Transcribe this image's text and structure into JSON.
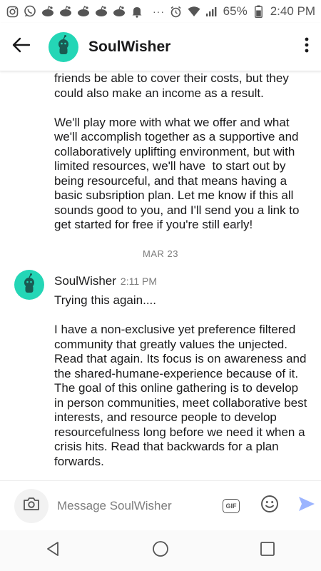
{
  "status_bar": {
    "battery_percent": "65%",
    "time": "2:40 PM",
    "more_indicator": "···",
    "icons": [
      "instagram-icon",
      "whatsapp-icon",
      "reddit-icon",
      "reddit-icon",
      "reddit-icon",
      "reddit-icon",
      "reddit-icon",
      "notification-bell-icon",
      "alarm-icon",
      "wifi-icon",
      "signal-icon",
      "battery-icon"
    ]
  },
  "header": {
    "title": "SoulWisher",
    "back_icon": "arrow-left-icon",
    "menu_icon": "more-vertical-icon"
  },
  "chat": {
    "previous_message_continued": "friends be able to cover their costs, but they could also make an income as a result.\n\nWe'll play more with what we offer and what we'll accomplish together as a supportive and collaboratively uplifting environment, but with limited resources, we'll have  to start out by being resourceful, and that means having a basic subsription plan. Let me know if this all sounds good to you, and I'll send you a link to get started for free if you're still early!",
    "date_separator": "MAR 23",
    "message": {
      "author": "SoulWisher",
      "time": "2:11 PM",
      "text": "Trying this again....\n\nI have a non-exclusive yet preference filtered community that greatly values the unjected. Read that again. Its focus is on awareness and the shared-humane-experience because of it. The goal of this online gathering is to develop in person communities, meet collaborative best interests, and resource people to develop resourcefulness long before we need it when a crisis hits. Read that backwards for a plan forwards."
    }
  },
  "composer": {
    "placeholder": "Message SoulWisher",
    "gif_label": "GIF",
    "accent_color": "#9bb4ff"
  },
  "colors": {
    "avatar": "#24d6b6",
    "send": "#9bb4ff"
  }
}
